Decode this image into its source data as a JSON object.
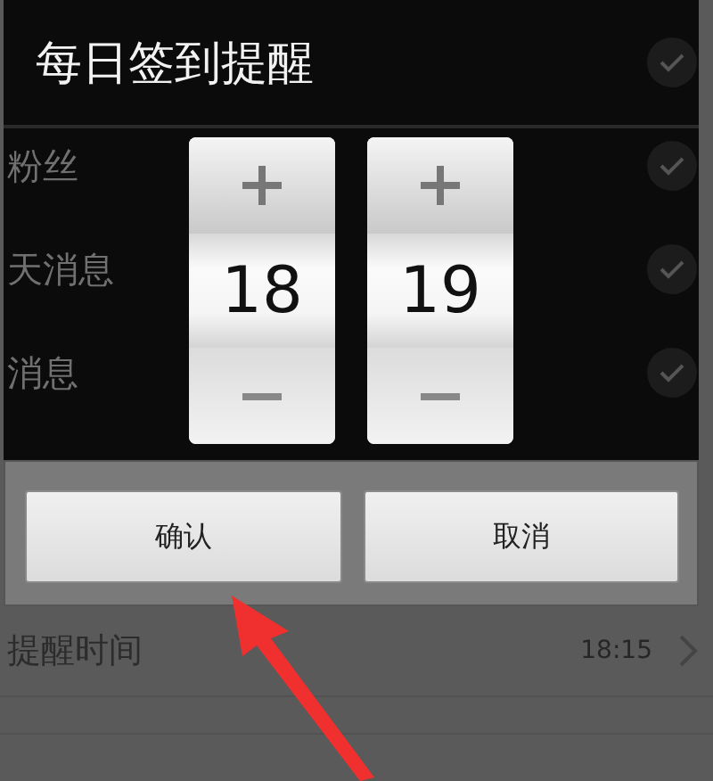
{
  "background_list": [
    {
      "checked": true
    },
    {
      "label": "粉丝",
      "checked": true
    },
    {
      "label": "天消息",
      "checked": true
    },
    {
      "label": "消息",
      "checked": true
    }
  ],
  "dialog": {
    "title": "每日签到提醒",
    "pickers": [
      {
        "value": "18"
      },
      {
        "value": "19"
      }
    ],
    "buttons": [
      "确认",
      "取消"
    ]
  },
  "reminder_row": {
    "label": "提醒时间",
    "value": "18:15"
  }
}
